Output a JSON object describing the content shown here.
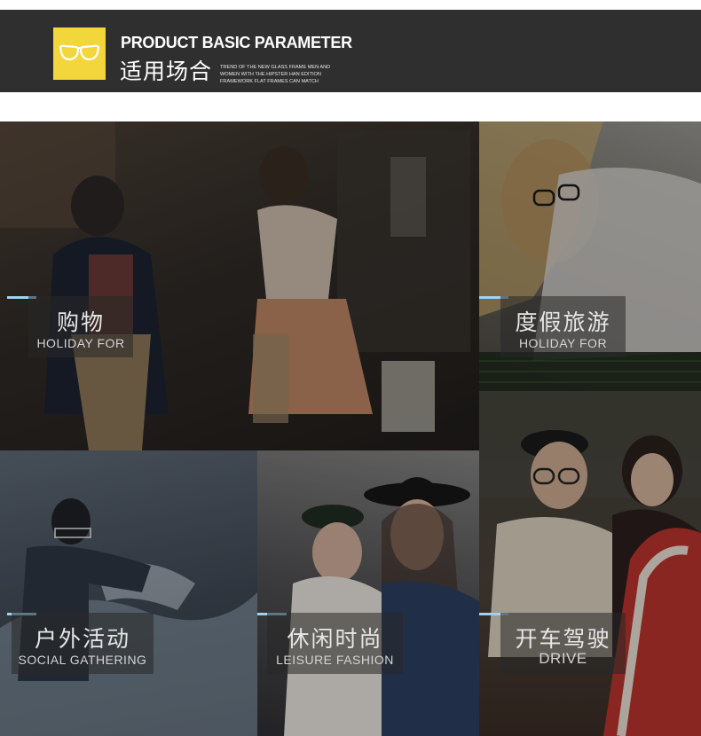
{
  "header": {
    "title_en": "PRODUCT BASIC PARAMETER",
    "title_cn": "适用场合",
    "desc_lines": [
      "TREND OF THE NEW GLASS FRAME MEN AND",
      "WOMEN WITH THE HIPSTER HAN EDITION",
      "FRAMEWORK FLAT FRAMES CAN MATCH"
    ],
    "icon": "glasses-icon",
    "accent": "#f3d63b"
  },
  "tiles": [
    {
      "cn": "购物",
      "en": "HOLIDAY FOR"
    },
    {
      "cn": "度假旅游",
      "en": "HOLIDAY FOR"
    },
    {
      "cn": "户外活动",
      "en": "SOCIAL GATHERING"
    },
    {
      "cn": "休闲时尚",
      "en": "LEISURE FASHION"
    },
    {
      "cn": "开车驾驶",
      "en": "DRIVE"
    }
  ],
  "colors": {
    "header_bg": "#2f2f2f",
    "label_bar": "#9fd3f0"
  }
}
